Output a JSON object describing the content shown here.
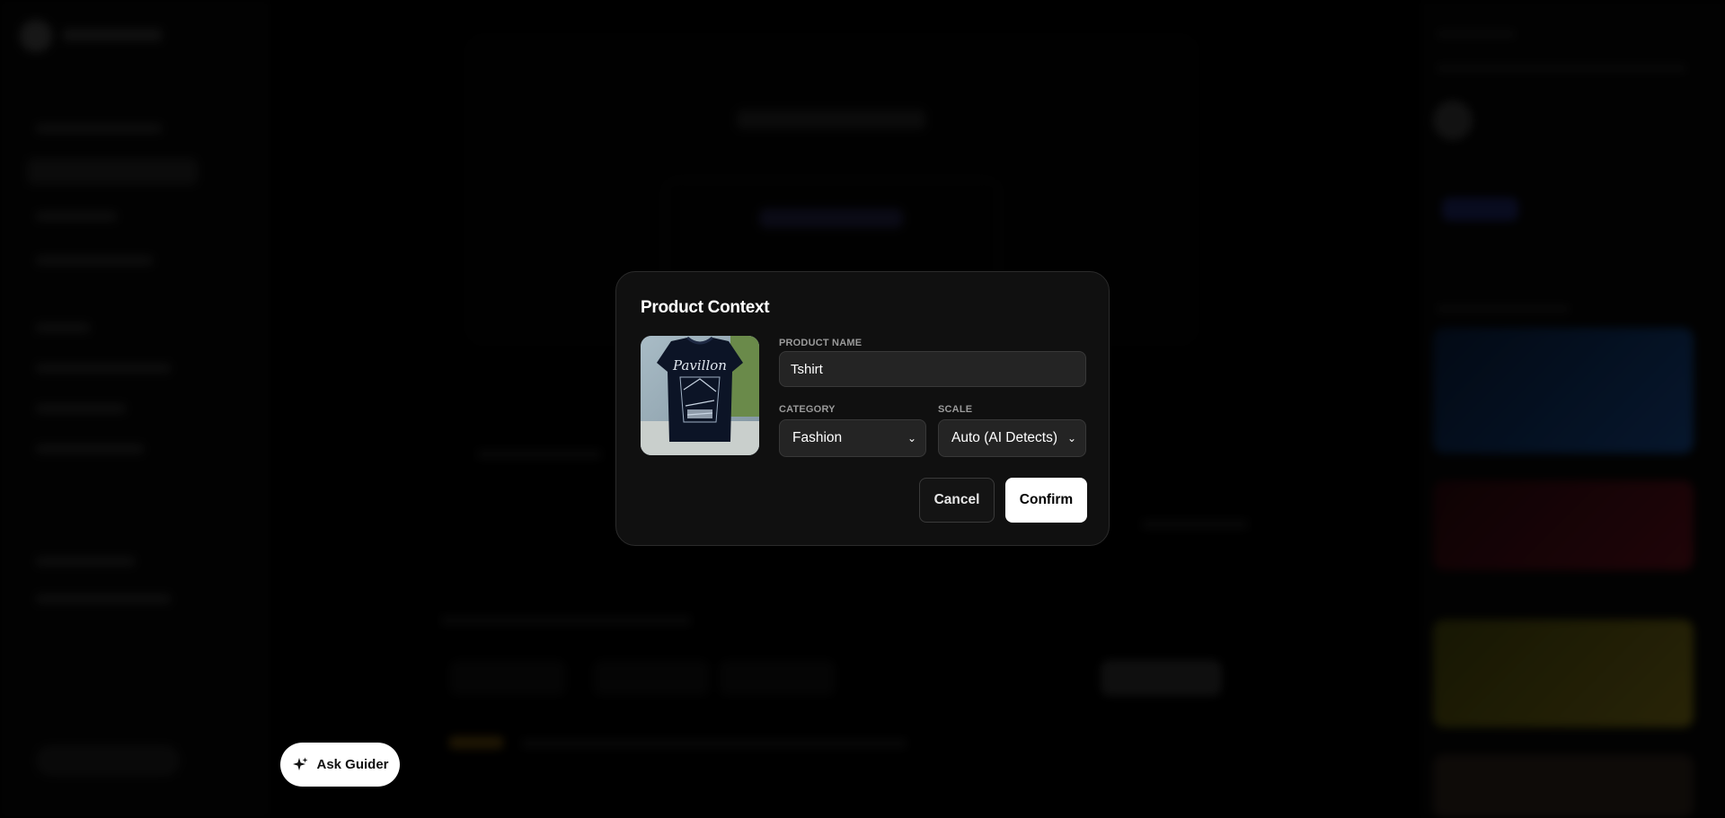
{
  "modal": {
    "title": "Product Context",
    "product_name_label": "PRODUCT NAME",
    "product_name_value": "Tshirt",
    "category_label": "CATEGORY",
    "category_value": "Fashion",
    "scale_label": "SCALE",
    "scale_value": "Auto (AI Detects)",
    "cancel_label": "Cancel",
    "confirm_label": "Confirm",
    "image_text": "Pavillon"
  },
  "ask_guider": {
    "label": "Ask Guider",
    "icon": "sparkle-icon"
  }
}
